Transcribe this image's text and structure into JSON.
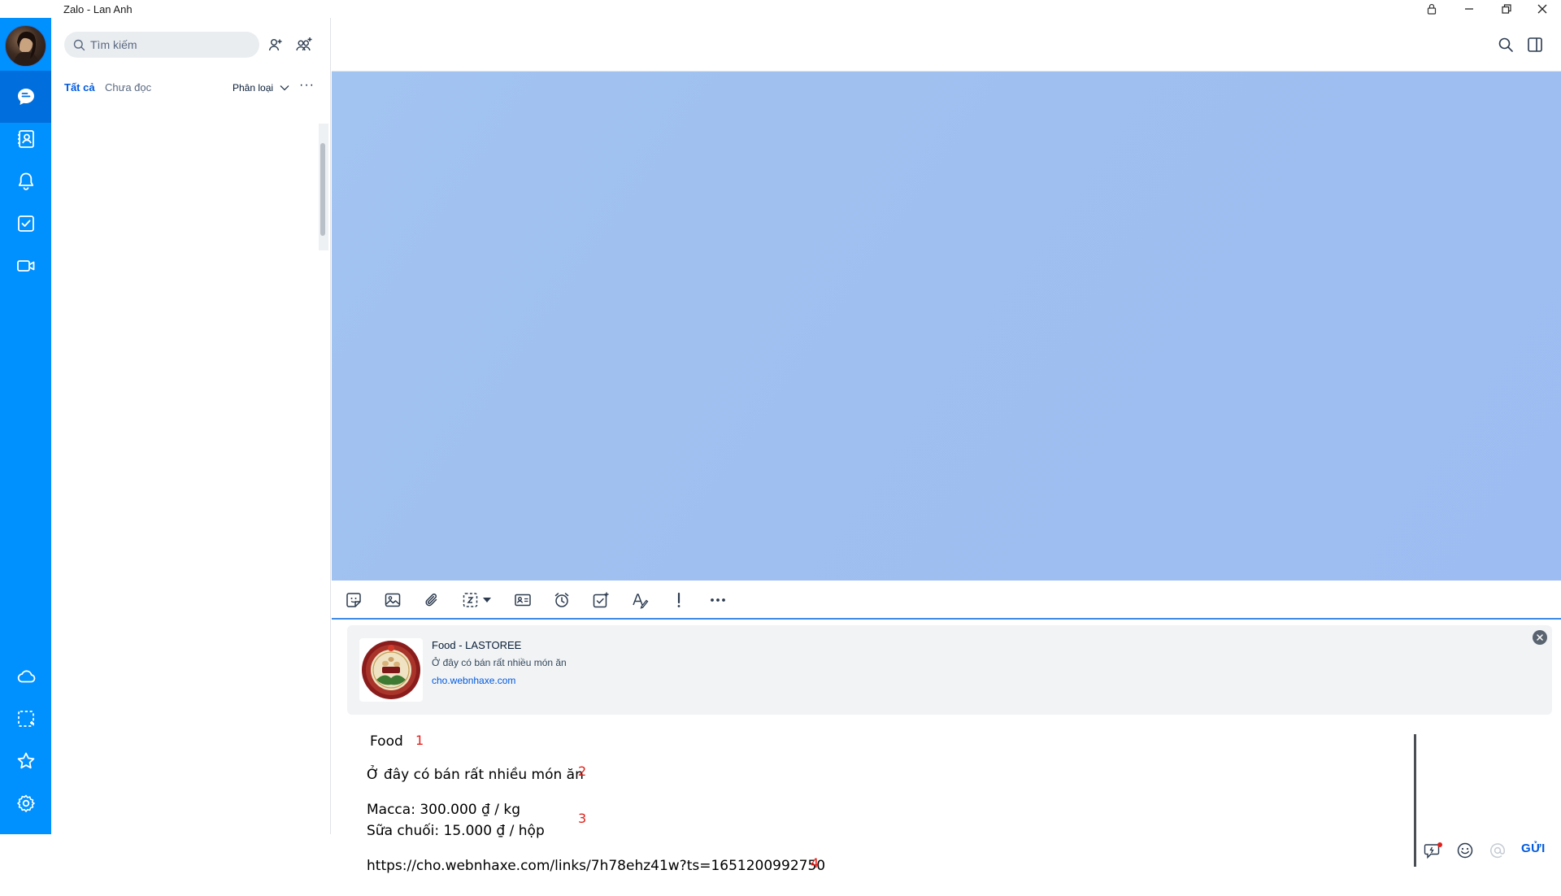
{
  "window": {
    "title": "Zalo - Lan Anh"
  },
  "nav": {
    "items": [
      {
        "name": "messages",
        "icon": "chat-bubble-icon"
      },
      {
        "name": "contacts",
        "icon": "contact-book-icon"
      },
      {
        "name": "notifications",
        "icon": "bell-icon"
      },
      {
        "name": "todo",
        "icon": "checkbox-icon"
      },
      {
        "name": "video-call",
        "icon": "video-camera-icon"
      },
      {
        "name": "cloud",
        "icon": "cloud-icon"
      },
      {
        "name": "screenshot",
        "icon": "screenshot-icon"
      },
      {
        "name": "favorites",
        "icon": "star-icon"
      },
      {
        "name": "settings",
        "icon": "gear-icon"
      }
    ],
    "colors": {
      "rail": "#0091ff",
      "active": "#006edc"
    }
  },
  "list": {
    "search_placeholder": "Tìm kiếm",
    "tabs": [
      {
        "label": "Tất cả",
        "active": true
      },
      {
        "label": "Chưa đọc",
        "active": false
      }
    ],
    "classify_label": "Phân loại",
    "more_label": "···"
  },
  "toolbar": {
    "tools": [
      "sticker-icon",
      "image-icon",
      "paperclip-icon",
      "zcloud-capture-icon",
      "business-card-icon",
      "alarm-clock-icon",
      "task-checkbox-icon",
      "text-format-icon",
      "exclamation-icon",
      "more-dots-icon"
    ]
  },
  "preview": {
    "title": "Food - LASTOREE",
    "description": "Ở đây có bán rất nhiều món ăn",
    "domain": "cho.webnhaxe.com"
  },
  "composer": {
    "lines": [
      {
        "text": "Food",
        "marker": "1"
      },
      {
        "text": "Ở đây có bán rất nhiều món ăn",
        "marker": "2"
      },
      {
        "text": "Macca: 300.000 ₫ / kg",
        "marker": "3"
      },
      {
        "text": "Sữa chuối: 15.000 ₫ / hộp",
        "marker": ""
      },
      {
        "text": "https://cho.webnhaxe.com/links/7h78ehz41w?ts=1651200992750",
        "marker": "4"
      }
    ],
    "send_label": "GỬI"
  },
  "colors": {
    "accent": "#005ae0",
    "chat_bg": "#a0c0f1",
    "marker": "#e0201b"
  }
}
